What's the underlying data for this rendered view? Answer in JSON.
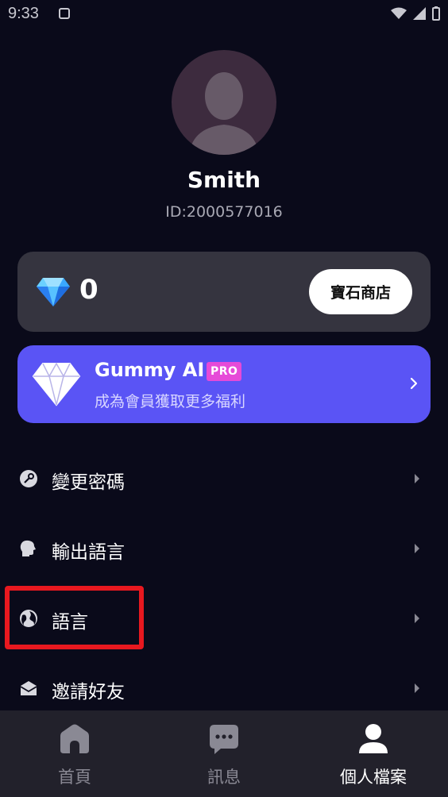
{
  "status_bar": {
    "time": "9:33"
  },
  "profile": {
    "name": "Smith",
    "id": "ID:2000577016"
  },
  "gems": {
    "count": "0",
    "store_label": "寶石商店"
  },
  "pro": {
    "title": "Gummy AI",
    "badge": "PRO",
    "subtitle": "成為會員獲取更多福利"
  },
  "menu": {
    "items": [
      {
        "label": "變更密碼",
        "icon": "key-icon"
      },
      {
        "label": "輸出語言",
        "icon": "speaking-head-icon"
      },
      {
        "label": "語言",
        "icon": "globe-icon"
      },
      {
        "label": "邀請好友",
        "icon": "envelope-icon"
      }
    ]
  },
  "bottom_nav": {
    "tabs": [
      {
        "label": "首頁",
        "icon": "home-icon"
      },
      {
        "label": "訊息",
        "icon": "chat-bubble-icon"
      },
      {
        "label": "個人檔案",
        "icon": "person-icon"
      }
    ],
    "active_index": 2
  },
  "colors": {
    "background": "#0a0a1a",
    "card": "#35343f",
    "pro_card": "#5a54f5",
    "pro_badge": "#e64ad8",
    "highlight": "#e8181f",
    "nav_bar": "#22212b"
  }
}
